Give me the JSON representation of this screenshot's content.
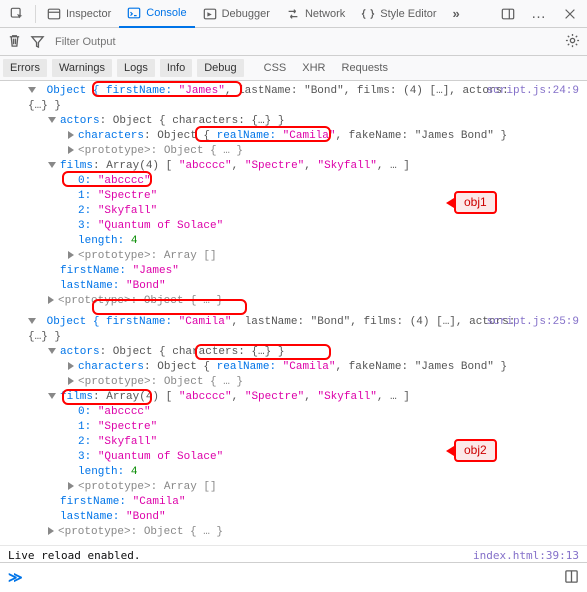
{
  "top_tabs": {
    "picker_icon": "element-picker-icon",
    "inspector": "Inspector",
    "console": "Console",
    "debugger": "Debugger",
    "network": "Network",
    "style_editor": "Style Editor",
    "more": "»",
    "dock_icon": "dock-icon",
    "overflow": "…",
    "close": "×"
  },
  "toolbar2": {
    "trash_icon": "trash-icon",
    "filter_placeholder": "Filter Output",
    "settings_icon": "gear-icon"
  },
  "filters": {
    "errors": "Errors",
    "warnings": "Warnings",
    "logs": "Logs",
    "info": "Info",
    "debug": "Debug",
    "css": "CSS",
    "xhr": "XHR",
    "requests": "Requests"
  },
  "obj1": {
    "location": "script.js:24:9",
    "head_pre": "Object { ",
    "head_fn_k": "firstName:",
    "head_fn_v": "\"James\"",
    "head_rest": ", lastName: \"Bond\", films: (4) […], actors: ",
    "head_tail": "{…} }",
    "actors_line": "actors: Object { characters: {…} }",
    "actors_char_pre": "characters: Object { ",
    "actors_rn_k": "realName:",
    "actors_rn_v": "\"Camila\"",
    "actors_char_post": ", fakeName: \"James Bond\" }",
    "proto1": "<prototype>: Object { … }",
    "films_head": "films: Array(4) [ \"abcccc\", \"Spectre\", \"Skyfall\", … ]",
    "films_0_k": "0:",
    "films_0_v": "\"abcccc\"",
    "films_1_k": "1:",
    "films_1_v": "\"Spectre\"",
    "films_2_k": "2:",
    "films_2_v": "\"Skyfall\"",
    "films_3_k": "3:",
    "films_3_v": "\"Quantum of Solace\"",
    "films_len_k": "length:",
    "films_len_v": "4",
    "proto2": "<prototype>: Array []",
    "fn_k": "firstName:",
    "fn_v": "\"James\"",
    "ln_k": "lastName:",
    "ln_v": "\"Bond\"",
    "proto3": "<prototype>: Object { … }"
  },
  "obj2": {
    "location": "script.js:25:9",
    "head_pre": "Object { ",
    "head_fn_k": "firstName:",
    "head_fn_v": "\"Camila\"",
    "head_rest": ", lastName: \"Bond\", films: (4) […], actors: ",
    "head_tail": "{…} }",
    "actors_line": "actors: Object { characters: {…} }",
    "actors_char_pre": "characters: Object { ",
    "actors_rn_k": "realName:",
    "actors_rn_v": "\"Camila\"",
    "actors_char_post": ", fakeName: \"James Bond\" }",
    "proto1": "<prototype>: Object { … }",
    "films_head": "films: Array(4) [ \"abcccc\", \"Spectre\", \"Skyfall\", … ]",
    "films_0_k": "0:",
    "films_0_v": "\"abcccc\"",
    "films_1_k": "1:",
    "films_1_v": "\"Spectre\"",
    "films_2_k": "2:",
    "films_2_v": "\"Skyfall\"",
    "films_3_k": "3:",
    "films_3_v": "\"Quantum of Solace\"",
    "films_len_k": "length:",
    "films_len_v": "4",
    "proto2": "<prototype>: Array []",
    "fn_k": "firstName:",
    "fn_v": "\"Camila\"",
    "ln_k": "lastName:",
    "ln_v": "\"Bond\"",
    "proto3": "<prototype>: Object { … }"
  },
  "live_reload": {
    "text": "Live reload enabled.",
    "loc": "index.html:39:13"
  },
  "annotations": {
    "label1": "obj1",
    "label2": "obj2"
  },
  "prompt": {
    "glyph": "≫"
  }
}
